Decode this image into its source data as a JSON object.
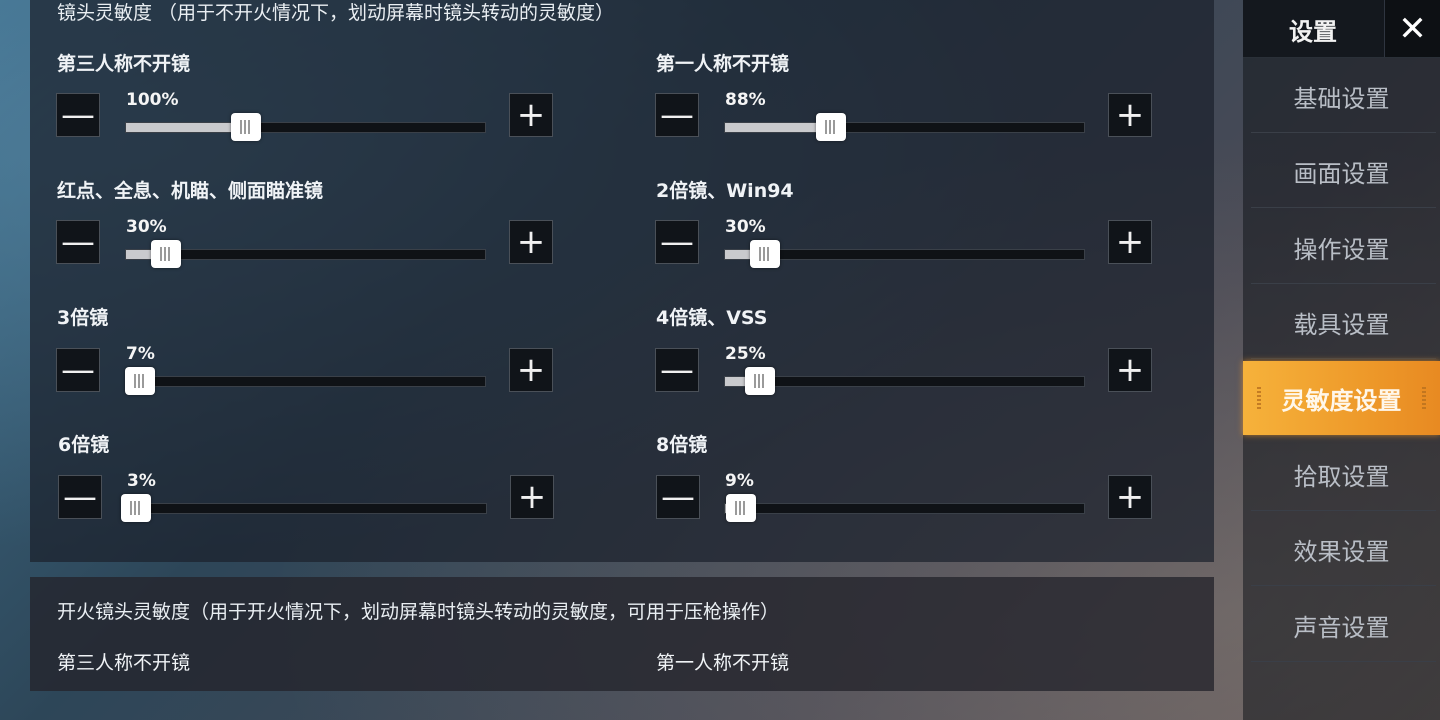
{
  "section1": {
    "title": "镜头灵敏度 （用于不开火情况下，划动屏幕时镜头转动的灵敏度）",
    "sliders": [
      {
        "label": "第三人称不开镜",
        "percent": "100%",
        "value": 100
      },
      {
        "label": "第一人称不开镜",
        "percent": "88%",
        "value": 88
      },
      {
        "label": "红点、全息、机瞄、侧面瞄准镜",
        "percent": "30%",
        "value": 30
      },
      {
        "label": "2倍镜、Win94",
        "percent": "30%",
        "value": 30
      },
      {
        "label": "3倍镜",
        "percent": "7%",
        "value": 7
      },
      {
        "label": "4倍镜、VSS",
        "percent": "25%",
        "value": 25
      },
      {
        "label": "6倍镜",
        "percent": "3%",
        "value": 3
      },
      {
        "label": "8倍镜",
        "percent": "9%",
        "value": 9
      }
    ],
    "minus_symbol": "—",
    "plus_symbol": "+"
  },
  "section2": {
    "title": "开火镜头灵敏度（用于开火情况下，划动屏幕时镜头转动的灵敏度，可用于压枪操作）",
    "labels": [
      "第三人称不开镜",
      "第一人称不开镜"
    ]
  },
  "sidebar": {
    "title": "设置",
    "close_symbol": "✕",
    "items": [
      "基础设置",
      "画面设置",
      "操作设置",
      "载具设置",
      "灵敏度设置",
      "拾取设置",
      "效果设置",
      "声音设置"
    ],
    "active_index": 4
  },
  "colors": {
    "accent": "#f0a030",
    "track_fill": "#c9cacd",
    "track_empty": "#0f1216"
  }
}
